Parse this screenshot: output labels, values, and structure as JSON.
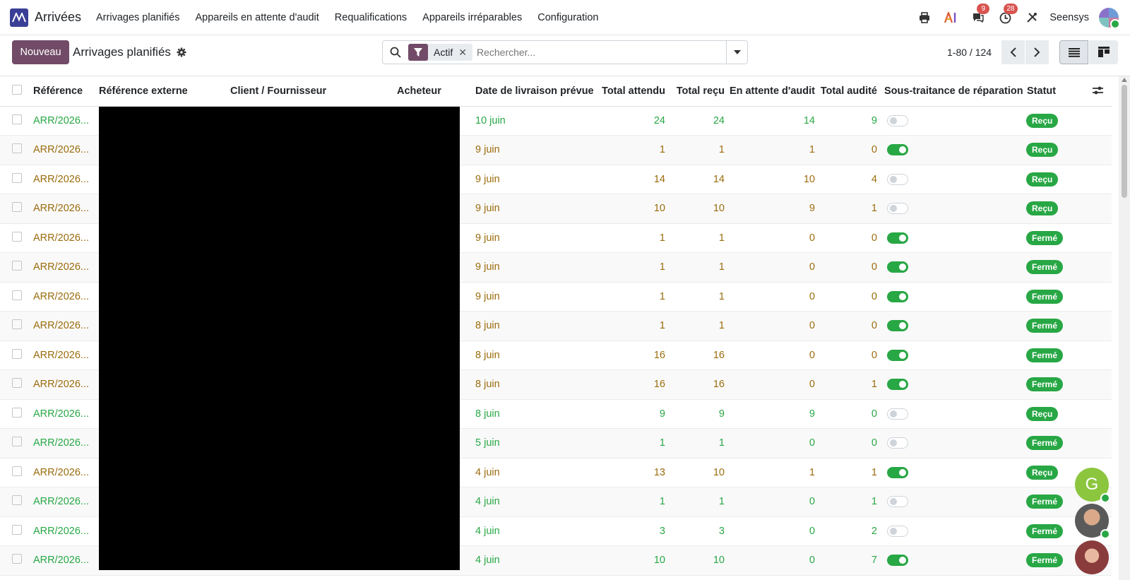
{
  "navbar": {
    "app_name": "Arrivées",
    "menu": [
      "Arrivages planifiés",
      "Appareils en attente d'audit",
      "Requalifications",
      "Appareils irréparables",
      "Configuration"
    ],
    "messages_count": "9",
    "activities_count": "28",
    "company": "Seensys"
  },
  "control": {
    "new_button": "Nouveau",
    "title": "Arrivages planifiés",
    "facet_label": "Actif",
    "search_placeholder": "Rechercher...",
    "pager": "1-80 / 124"
  },
  "table": {
    "headers": [
      "Référence",
      "Référence externe",
      "Client / Fournisseur",
      "Acheteur",
      "Date de livraison prévue",
      "Total attendu",
      "Total reçu",
      "En attente d'audit",
      "Total audité",
      "Sous-traitance de réparation",
      "Statut"
    ],
    "rows": [
      {
        "ref": "ARR/2026...",
        "date": "10 juin",
        "expected": "24",
        "received": "24",
        "pending": "14",
        "audited": "9",
        "subcontract": false,
        "status": "Reçu",
        "ref_color": "green"
      },
      {
        "ref": "ARR/2026...",
        "date": "9 juin",
        "expected": "1",
        "received": "1",
        "pending": "1",
        "audited": "0",
        "subcontract": true,
        "status": "Reçu",
        "ref_color": "gold"
      },
      {
        "ref": "ARR/2026...",
        "date": "9 juin",
        "expected": "14",
        "received": "14",
        "pending": "10",
        "audited": "4",
        "subcontract": false,
        "status": "Reçu",
        "ref_color": "gold"
      },
      {
        "ref": "ARR/2026...",
        "date": "9 juin",
        "expected": "10",
        "received": "10",
        "pending": "9",
        "audited": "1",
        "subcontract": false,
        "status": "Reçu",
        "ref_color": "gold"
      },
      {
        "ref": "ARR/2026...",
        "date": "9 juin",
        "expected": "1",
        "received": "1",
        "pending": "0",
        "audited": "0",
        "subcontract": true,
        "status": "Fermé",
        "ref_color": "gold"
      },
      {
        "ref": "ARR/2026...",
        "date": "9 juin",
        "expected": "1",
        "received": "1",
        "pending": "0",
        "audited": "0",
        "subcontract": true,
        "status": "Fermé",
        "ref_color": "gold"
      },
      {
        "ref": "ARR/2026...",
        "date": "9 juin",
        "expected": "1",
        "received": "1",
        "pending": "0",
        "audited": "0",
        "subcontract": true,
        "status": "Fermé",
        "ref_color": "gold"
      },
      {
        "ref": "ARR/2026...",
        "date": "8 juin",
        "expected": "1",
        "received": "1",
        "pending": "0",
        "audited": "0",
        "subcontract": true,
        "status": "Fermé",
        "ref_color": "gold"
      },
      {
        "ref": "ARR/2026...",
        "date": "8 juin",
        "expected": "16",
        "received": "16",
        "pending": "0",
        "audited": "0",
        "subcontract": true,
        "status": "Fermé",
        "ref_color": "gold"
      },
      {
        "ref": "ARR/2026...",
        "date": "8 juin",
        "expected": "16",
        "received": "16",
        "pending": "0",
        "audited": "1",
        "subcontract": true,
        "status": "Fermé",
        "ref_color": "gold"
      },
      {
        "ref": "ARR/2026...",
        "date": "8 juin",
        "expected": "9",
        "received": "9",
        "pending": "9",
        "audited": "0",
        "subcontract": false,
        "status": "Reçu",
        "ref_color": "green"
      },
      {
        "ref": "ARR/2026...",
        "date": "5 juin",
        "expected": "1",
        "received": "1",
        "pending": "0",
        "audited": "0",
        "subcontract": false,
        "status": "Fermé",
        "ref_color": "green"
      },
      {
        "ref": "ARR/2026...",
        "date": "4 juin",
        "expected": "13",
        "received": "10",
        "pending": "1",
        "audited": "1",
        "subcontract": true,
        "status": "Reçu",
        "ref_color": "gold"
      },
      {
        "ref": "ARR/2026...",
        "date": "4 juin",
        "expected": "1",
        "received": "1",
        "pending": "0",
        "audited": "1",
        "subcontract": false,
        "status": "Fermé",
        "ref_color": "green"
      },
      {
        "ref": "ARR/2026...",
        "date": "4 juin",
        "expected": "3",
        "received": "3",
        "pending": "0",
        "audited": "2",
        "subcontract": false,
        "status": "Fermé",
        "ref_color": "green"
      },
      {
        "ref": "ARR/2026...",
        "date": "4 juin",
        "expected": "10",
        "received": "10",
        "pending": "0",
        "audited": "7",
        "subcontract": true,
        "status": "Fermé",
        "ref_color": "green"
      }
    ]
  },
  "chat": {
    "initial": "G"
  },
  "colors": {
    "brand": "#714b67",
    "success": "#28a745",
    "warning_text": "#9b6c0d"
  }
}
